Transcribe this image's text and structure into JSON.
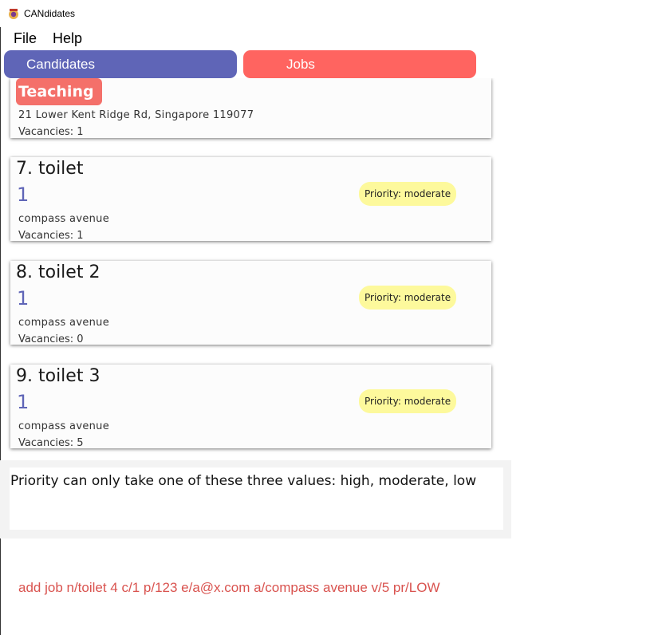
{
  "window": {
    "title": "CANdidates"
  },
  "menu": {
    "file": "File",
    "help": "Help"
  },
  "tabs": {
    "candidates": "Candidates",
    "jobs": "Jobs"
  },
  "partial_card": {
    "tag": "Teaching",
    "address": "21 Lower Kent Ridge Rd, Singapore 119077",
    "vacancies": "Vacancies: 1"
  },
  "jobs": [
    {
      "title": "7.  toilet",
      "company": "1",
      "address": "compass avenue",
      "vacancies": "Vacancies: 1",
      "priority": "Priority: moderate"
    },
    {
      "title": "8.  toilet 2",
      "company": "1",
      "address": "compass avenue",
      "vacancies": "Vacancies: 0",
      "priority": "Priority: moderate"
    },
    {
      "title": "9.  toilet 3",
      "company": "1",
      "address": "compass avenue",
      "vacancies": "Vacancies: 5",
      "priority": "Priority: moderate"
    }
  ],
  "result": {
    "message": "Priority can only take one of these three values: high, moderate, low"
  },
  "command": {
    "text": "add job n/toilet 4 c/1 p/123 e/a@x.com a/compass avenue v/5 pr/LOW"
  },
  "colors": {
    "candidates_tab": "#5f65b7",
    "jobs_tab": "#ff6460",
    "priority_badge": "#fdf99c",
    "tag": "#f4706a",
    "command_text": "#d9534f"
  }
}
